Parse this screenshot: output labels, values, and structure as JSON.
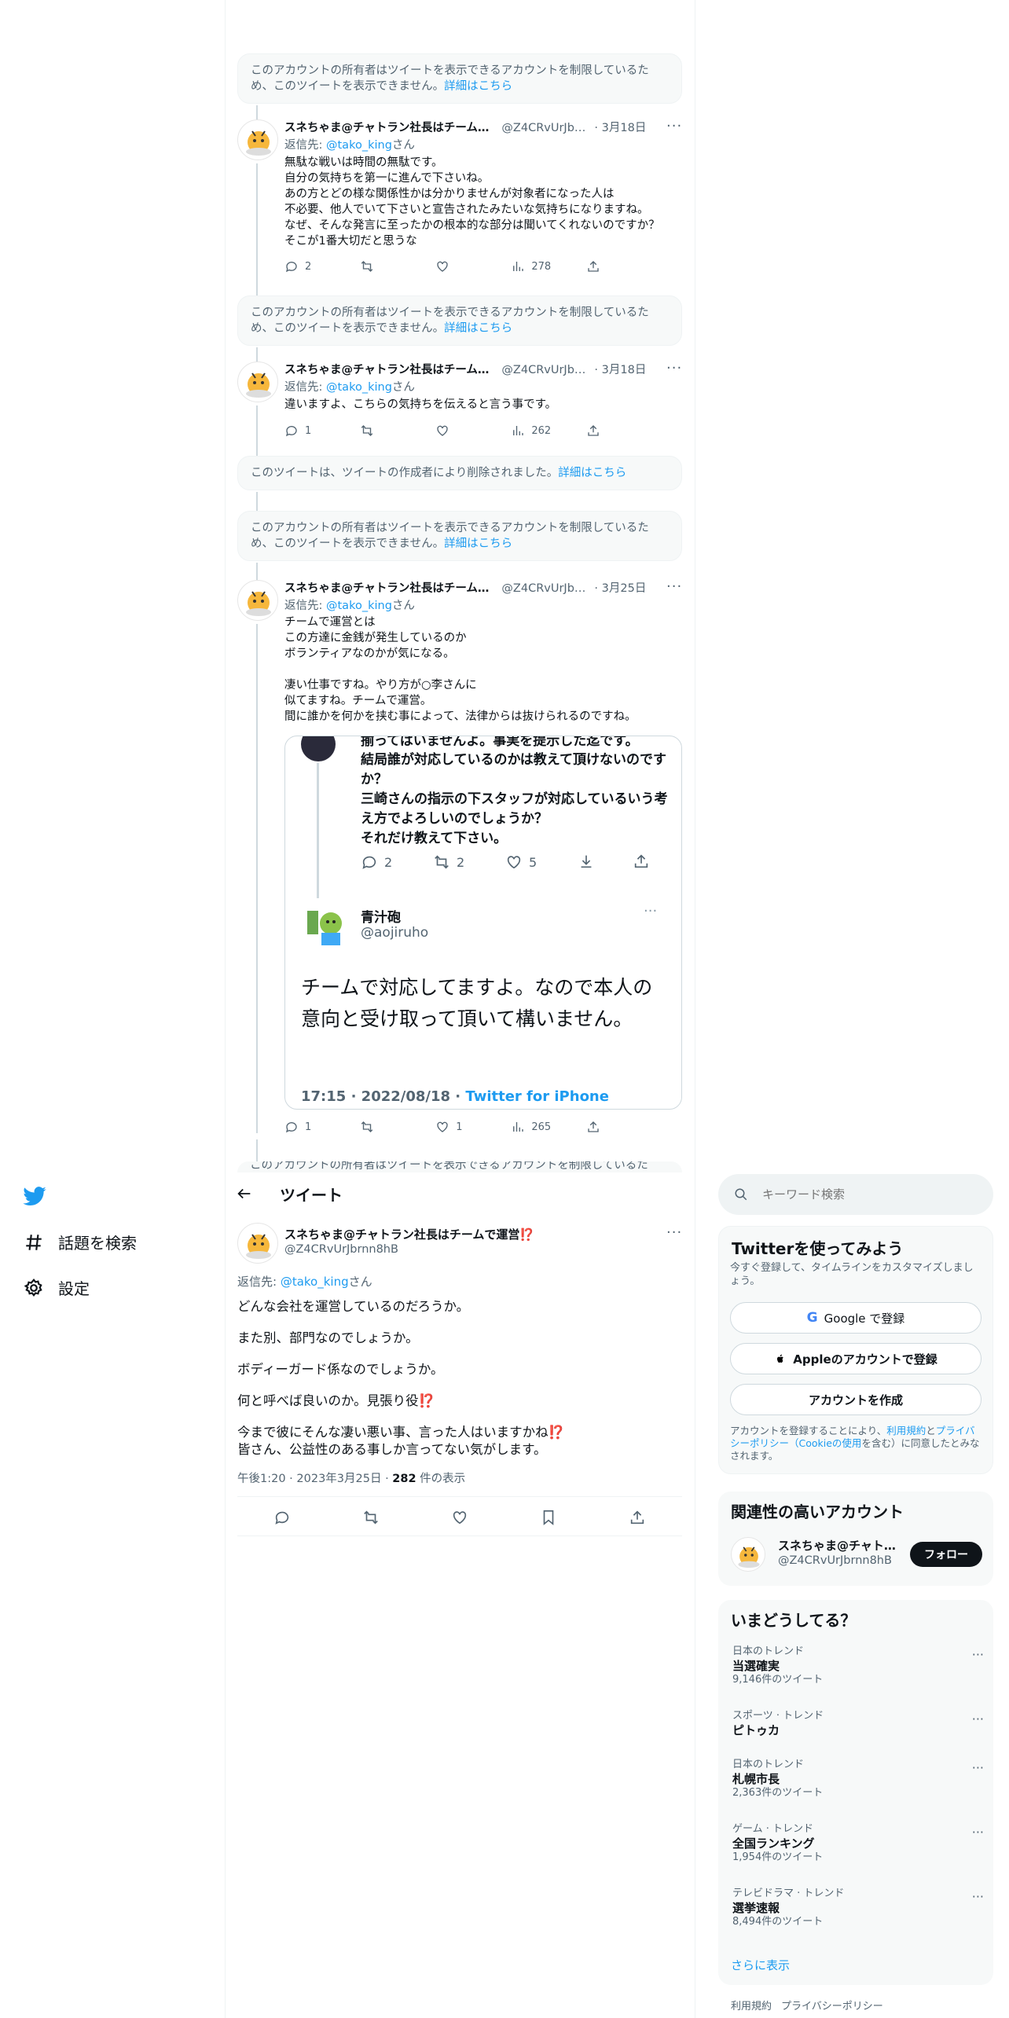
{
  "notices": {
    "restricted": "このアカウントの所有者はツイートを表示できるアカウントを制限しているため、このツイートを表示できません。",
    "deleted": "このツイートは、ツイートの作成者により削除されました。",
    "link": "詳細はこちら",
    "partial": "このアカウントの所有者はツイートを表示できるアカウントを制限しているた"
  },
  "author": {
    "name": "スネちゃま@チャトラン社長はチーム…",
    "handle": "@Z4CRvUrJbr…",
    "full_name": "スネちゃま@チャトラン社長はチームで運営",
    "full_handle": "@Z4CRvUrJbrnn8hB",
    "emoji": "⁉️"
  },
  "reply_prefix": "返信先: ",
  "reply_user": "@tako_king",
  "reply_suffix": "さん",
  "more": "···",
  "tweets": [
    {
      "date": "· 3月18日",
      "body": "無駄な戦いは時間の無駄です。\n自分の気持ちを第一に進んで下さいね。\nあの方とどの様な関係性かは分かりませんが対象者になった人は\n不必要、他人でいて下さいと宣告されたみたいな気持ちになりますね。\nなぜ、そんな発言に至ったかの根本的な部分は聞いてくれないのですか？\nそこが1番大切だと思うな",
      "replies": "2",
      "retweets": "",
      "likes": "",
      "views": "278"
    },
    {
      "date": "· 3月18日",
      "body": "違いますよ、こちらの気持ちを伝えると言う事です。",
      "replies": "1",
      "retweets": "",
      "likes": "",
      "views": "262"
    },
    {
      "date": "· 3月25日",
      "body": "チームで運営とは\nこの方達に金銭が発生しているのか\nボランティアなのかが気になる。\n\n凄い仕事ですね。やり方が○李さんに\n似てますね。チームで運営。\n間に誰かを何かを挟む事によって、法律からは抜けられるのですね。",
      "replies": "1",
      "retweets": "",
      "likes": "1",
      "views": "265"
    }
  ],
  "embed": {
    "cut_top": "揃ってはいませんよ。事実を提示した迄です。",
    "quote_lines": "結局誰が対応しているのかは教えて頂けないのですか？\n三崎さんの指示の下スタッフが対応しているいう考え方でよろしいのでしょうか？\nそれだけ教えて下さい。",
    "q_replies": "2",
    "q_retweets": "2",
    "q_likes": "5",
    "name": "青汁砲",
    "handle": "@aojiruho",
    "text": "チームで対応してますよ。なので本人の意向と受け取って頂いて構いません。",
    "time": "17:15 · 2022/08/18 · ",
    "client": "Twitter for iPhone"
  },
  "nav": {
    "explore": "話題を検索",
    "settings": "設定"
  },
  "header": {
    "title": "ツイート"
  },
  "main_tweet": {
    "lines": [
      "どんな会社を運営しているのだろうか。",
      "また別、部門なのでしょうか。",
      "ボディーガード係なのでしょうか。",
      "何と呼べば良いのか。見張り役",
      "今まで彼にそんな凄い悪い事、言った人はいますかね",
      "皆さん、公益性のある事しか言ってない気がします。"
    ],
    "time": "午後1:20 · 2023年3月25日 · ",
    "views": "282",
    "views_label": " 件の表示"
  },
  "search": {
    "placeholder": "キーワード検索"
  },
  "signup": {
    "title": "Twitterを使ってみよう",
    "subtitle": "今すぐ登録して、タイムラインをカスタマイズしましょう。",
    "google": "Google で登録",
    "apple": "Appleのアカウントで登録",
    "create": "アカウントを作成",
    "terms_pre": "アカウントを登録することにより、",
    "terms_link": "利用規約",
    "terms_mid": "と",
    "privacy_link": "プライバシーポリシー（Cookieの使用",
    "terms_post": "を含む）に同意したとみなされます。"
  },
  "related": {
    "title": "関連性の高いアカウント",
    "name": "スネちゃま@チャト…",
    "handle": "@Z4CRvUrJbrnn8hB",
    "follow": "フォロー"
  },
  "trends": {
    "title": "いまどうしてる？",
    "items": [
      {
        "category": "日本のトレンド",
        "title": "当選確実",
        "count": "9,146件のツイート"
      },
      {
        "category": "スポーツ · トレンド",
        "title": "ピトゥカ",
        "count": ""
      },
      {
        "category": "日本のトレンド",
        "title": "札幌市長",
        "count": "2,363件のツイート"
      },
      {
        "category": "ゲーム · トレンド",
        "title": "全国ランキング",
        "count": "1,954件のツイート"
      },
      {
        "category": "テレビドラマ · トレンド",
        "title": "選挙速報",
        "count": "8,494件のツイート"
      }
    ],
    "more": "さらに表示"
  },
  "footer": {
    "terms": "利用規約",
    "privacy": "プライバシーポリシー"
  },
  "colors": {
    "accent": "#1d9bf0",
    "text": "#0f1419",
    "muted": "#536471"
  }
}
